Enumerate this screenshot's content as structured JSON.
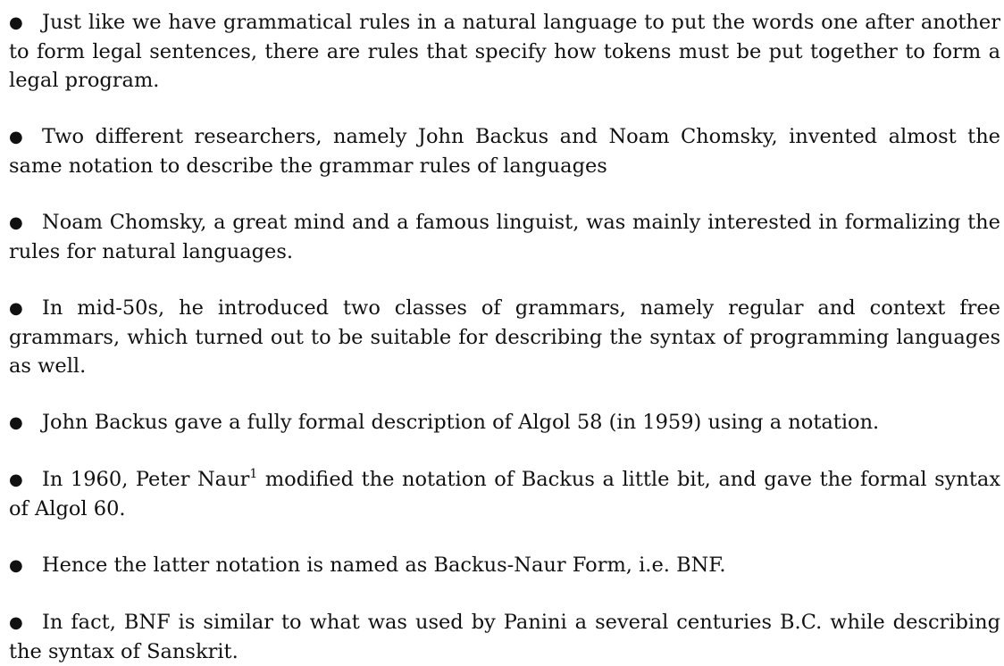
{
  "bullet_symbol": "●",
  "items": [
    {
      "text": "Just like we have grammatical rules in a natural language to put the words one after another to form legal sentences, there are rules that specify how tokens must be put together to form a legal program."
    },
    {
      "text": "Two different researchers, namely John Backus and Noam Chomsky, invented almost the same notation to describe the grammar rules of languages"
    },
    {
      "text": "Noam Chomsky, a great mind and a famous linguist, was mainly interested in formalizing the rules for natural languages."
    },
    {
      "text": "In mid-50s, he introduced two classes of grammars, namely regular and context free grammars, which turned out to be suitable for describing the syntax of programming languages as well."
    },
    {
      "text": "John Backus gave a fully formal description of Algol 58 (in 1959) using a notation."
    },
    {
      "text_before": "In 1960, Peter Naur",
      "footnote_mark": "1",
      "text_after": " modified the notation of Backus a little bit, and gave the formal syntax of Algol 60."
    },
    {
      "text": "Hence the latter notation is named as Backus-Naur Form, i.e. BNF."
    },
    {
      "text": "In fact, BNF is similar to what was used by Panini a several centuries B.C. while describing the syntax of Sanskrit."
    }
  ]
}
